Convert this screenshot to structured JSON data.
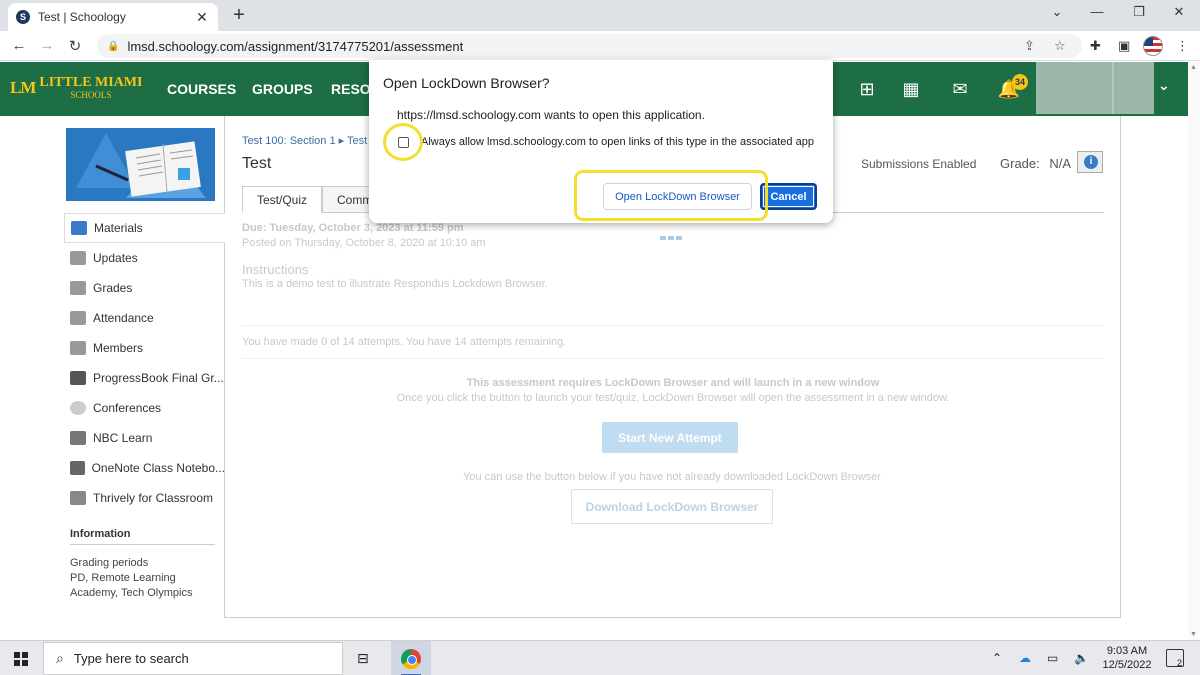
{
  "browser": {
    "tab_title": "Test | Schoology",
    "favicon_letter": "S",
    "url": "lmsd.schoology.com/assignment/3174775201/assessment"
  },
  "schoology": {
    "school_name_line1": "LITTLE MIAMI",
    "school_name_line2": "SCHOOLS",
    "logo_mark": "LM",
    "nav": [
      "COURSES",
      "GROUPS",
      "RESOURCES"
    ],
    "notification_count": "34"
  },
  "sidebar": {
    "items": [
      {
        "label": "Materials",
        "icon": "materials-icon"
      },
      {
        "label": "Updates",
        "icon": "updates-icon"
      },
      {
        "label": "Grades",
        "icon": "grades-icon"
      },
      {
        "label": "Attendance",
        "icon": "attendance-icon"
      },
      {
        "label": "Members",
        "icon": "members-icon"
      },
      {
        "label": "ProgressBook Final Gr...",
        "icon": "progressbook-icon"
      },
      {
        "label": "Conferences",
        "icon": "conferences-icon"
      },
      {
        "label": "NBC Learn",
        "icon": "nbc-learn-icon"
      },
      {
        "label": "OneNote Class Notebo...",
        "icon": "onenote-icon"
      },
      {
        "label": "Thrively for Classroom",
        "icon": "thrively-icon"
      }
    ],
    "info_heading": "Information",
    "info_label": "Grading periods",
    "info_value": "PD, Remote Learning Academy, Tech Olympics"
  },
  "main": {
    "breadcrumb": "Test 100: Section 1 ▸ Test",
    "title": "Test",
    "submissions": "Submissions Enabled",
    "grade_label": "Grade:",
    "grade_value": "N/A",
    "tabs": [
      "Test/Quiz",
      "Comm"
    ],
    "due": "Due: Tuesday, October 3, 2023 at 11:59 pm",
    "posted": "Posted on Thursday, October 8, 2020 at 10:10 am",
    "instructions_heading": "Instructions",
    "instructions_text": "This is a demo test to illustrate Respondus Lockdown Browser.",
    "attempts": "You have made 0 of 14 attempts. You have 14 attempts remaining.",
    "lockdown_req": "This assessment requires LockDown Browser and will launch in a new window",
    "lockdown_req2": "Once you click the button to launch your test/quiz, LockDown Browser will open the assessment in a new window.",
    "start_button": "Start New Attempt",
    "download_note": "You can use the button below if you have not already downloaded LockDown Browser",
    "download_button": "Download LockDown Browser"
  },
  "dialog": {
    "title": "Open LockDown Browser?",
    "message": "https://lmsd.schoology.com wants to open this application.",
    "checkbox_label": "Always allow lmsd.schoology.com to open links of this type in the associated app",
    "checkbox_checked": false,
    "open_button": "Open LockDown Browser",
    "cancel_button": "Cancel",
    "highlight_color": "#f3df2a"
  },
  "taskbar": {
    "search_placeholder": "Type here to search",
    "time": "9:03 AM",
    "date": "12/5/2022",
    "notification_count": "2"
  },
  "colors": {
    "header_green": "#1d6e44",
    "accent_blue": "#1a6fe0",
    "badge_yellow": "#f5c518"
  }
}
